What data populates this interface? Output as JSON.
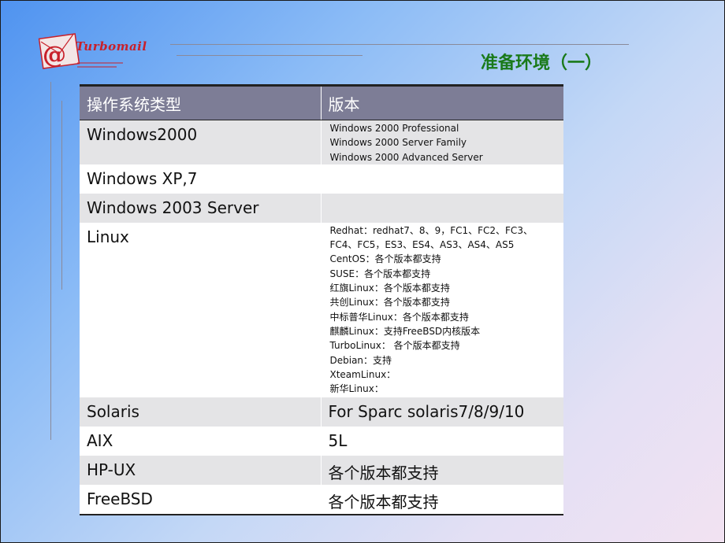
{
  "logo": {
    "text": "Turbomail"
  },
  "title": "准备环境（一）",
  "table": {
    "headers": [
      "操作系统类型",
      "版本"
    ],
    "rows": [
      {
        "os": "Windows2000",
        "versions": [
          "Windows 2000 Professional",
          "Windows 2000 Server Family",
          "Windows 2000 Advanced Server"
        ]
      },
      {
        "os": "Windows XP,7",
        "versions": []
      },
      {
        "os": "Windows 2003 Server",
        "versions": []
      },
      {
        "os": "Linux",
        "versions": [
          "Redhat：redhat7、8、9，FC1、FC2、FC3、FC4、FC5，ES3、ES4、AS3、AS4、AS5",
          "CentOS：各个版本都支持",
          "SUSE：各个版本都支持",
          "红旗Linux：各个版本都支持",
          "共创Linux：各个版本都支持",
          "中标普华Linux：各个版本都支持",
          "麒麟Linux：支持FreeBSD内核版本",
          "TurboLinux： 各个版本都支持",
          "Debian：支持",
          "XteamLinux：",
          "新华Linux："
        ]
      },
      {
        "os": "Solaris",
        "version": "For Sparc solaris7/8/9/10"
      },
      {
        "os": "AIX",
        "version": "5L"
      },
      {
        "os": "HP-UX",
        "version": "各个版本都支持"
      },
      {
        "os": "FreeBSD",
        "version": "各个版本都支持"
      }
    ]
  }
}
